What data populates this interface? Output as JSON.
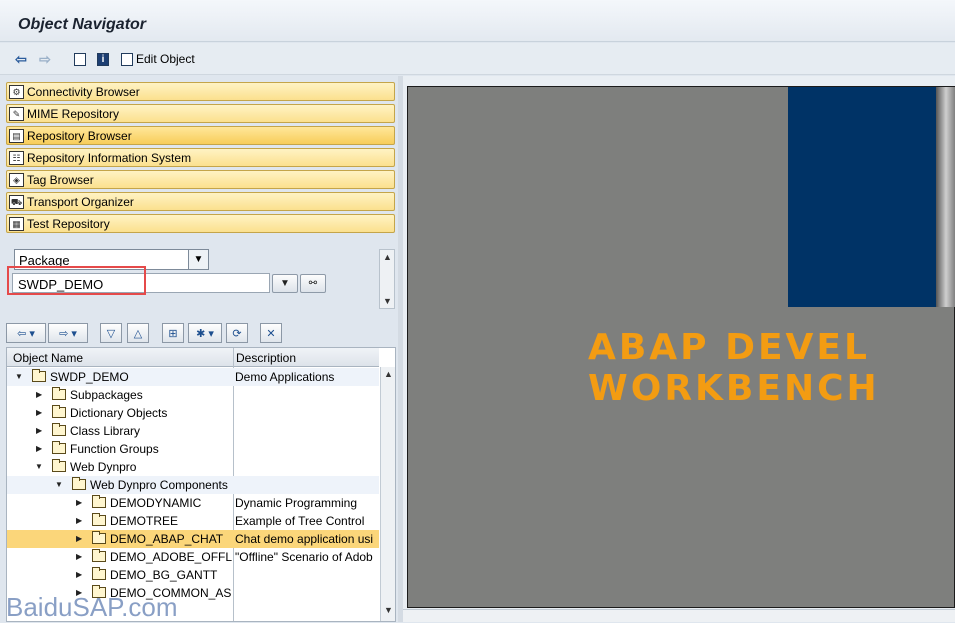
{
  "window": {
    "title": "Object Navigator"
  },
  "toolbar": {
    "edit_object_label": "Edit Object"
  },
  "nav_buttons": [
    {
      "label": "Connectivity Browser",
      "icon": "connectivity-icon"
    },
    {
      "label": "MIME Repository",
      "icon": "mime-icon"
    },
    {
      "label": "Repository Browser",
      "icon": "repository-icon"
    },
    {
      "label": "Repository Information System",
      "icon": "info-system-icon"
    },
    {
      "label": "Tag Browser",
      "icon": "tag-icon"
    },
    {
      "label": "Transport Organizer",
      "icon": "transport-icon"
    },
    {
      "label": "Test Repository",
      "icon": "test-icon"
    }
  ],
  "object_selector": {
    "type_value": "Package",
    "object_value": "SWDP_DEMO"
  },
  "tree": {
    "columns": [
      "Object Name",
      "Description"
    ],
    "rows": [
      {
        "name": "SWDP_DEMO",
        "description": "Demo Applications",
        "expanded": true
      },
      {
        "name": "Subpackages",
        "description": ""
      },
      {
        "name": "Dictionary Objects",
        "description": ""
      },
      {
        "name": "Class Library",
        "description": ""
      },
      {
        "name": "Function Groups",
        "description": ""
      },
      {
        "name": "Web Dynpro",
        "description": "",
        "expanded": true
      },
      {
        "name": "Web Dynpro Components",
        "description": "",
        "expanded": true
      },
      {
        "name": "DEMODYNAMIC",
        "description": "Dynamic Programming"
      },
      {
        "name": "DEMOTREE",
        "description": "Example of Tree Control"
      },
      {
        "name": "DEMO_ABAP_CHAT",
        "description": "Chat demo application usi",
        "selected": true
      },
      {
        "name": "DEMO_ADOBE_OFFLIN",
        "description": "\"Offline\" Scenario of Adob"
      },
      {
        "name": "DEMO_BG_GANTT",
        "description": ""
      },
      {
        "name": "DEMO_COMMON_ASSI",
        "description": ""
      }
    ]
  },
  "splash": {
    "line1": "ABAP DEVEL",
    "line2": "WORKBENCH"
  },
  "watermark": "BaiduSAP.com",
  "colors": {
    "nav_button": "#fbe08e",
    "selection": "#fbd67a",
    "splash_text": "#f39c12",
    "splash_blue": "#003366"
  }
}
